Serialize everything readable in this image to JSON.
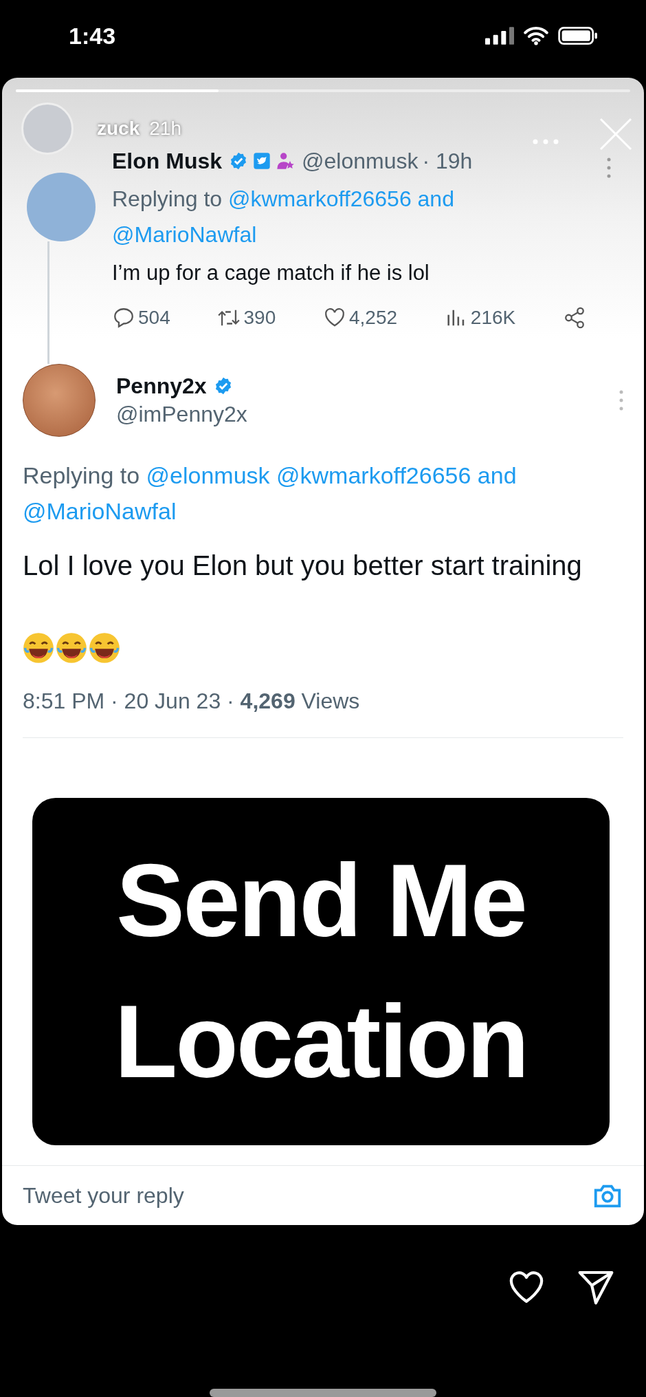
{
  "status_bar": {
    "time": "1:43"
  },
  "story": {
    "progress": {
      "level": 0.33
    },
    "user": "zuck",
    "time": "21h"
  },
  "parent_tweet": {
    "name": "Elon Musk",
    "handle": "@elonmusk",
    "time": "· 19h",
    "replying": [
      {
        "kind": "plain",
        "text": "Replying to"
      },
      {
        "kind": "mention",
        "text": "@kwmarkoff26656"
      },
      {
        "kind": "joiner",
        "text": "and"
      },
      {
        "kind": "mention",
        "text": "@MarioNawfal"
      }
    ],
    "text": "I’m up for a cage match if he is lol",
    "stats": [
      {
        "kind": "reply",
        "value": "504"
      },
      {
        "kind": "retweet",
        "value": "390"
      },
      {
        "kind": "like",
        "value": "4,252"
      },
      {
        "kind": "views",
        "value": "216K"
      },
      {
        "kind": "share"
      }
    ]
  },
  "tweet": {
    "name": "Penny2x",
    "handle": "@imPenny2x",
    "replying": [
      {
        "kind": "plain",
        "text": "Replying to"
      },
      {
        "kind": "mention",
        "text": "@elonmusk"
      },
      {
        "kind": "mention",
        "text": "@kwmarkoff26656"
      },
      {
        "kind": "joiner",
        "text": "and"
      },
      {
        "kind": "mention",
        "text": "@MarioNawfal"
      }
    ],
    "text": "Lol I love you Elon but you better start training",
    "meta": "8:51 PM · 20 Jun 23 · **4,269** Views"
  },
  "reply_box": {
    "placeholder": "Tweet your reply"
  },
  "caption": "Send Me Location"
}
